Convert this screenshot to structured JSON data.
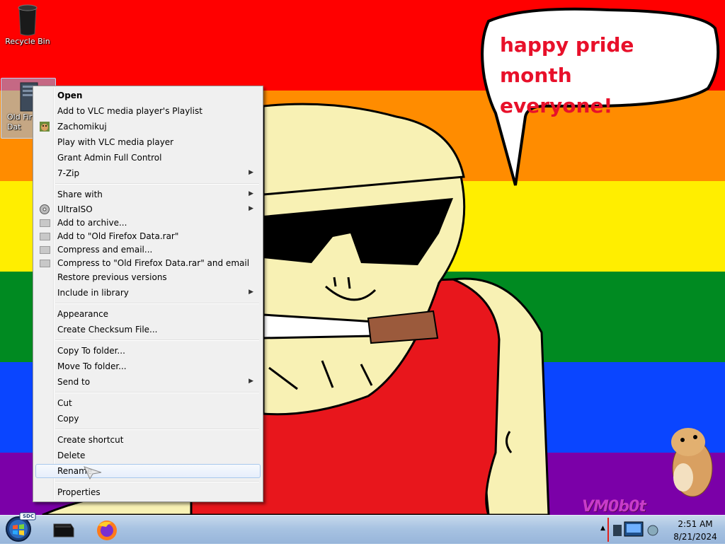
{
  "desktop": {
    "recycle_bin_label": "Recycle Bin",
    "selected_icon_label": "Old Firefox Data",
    "selected_icon_label_visible": "Old Fir\nDat"
  },
  "wallpaper": {
    "speech_line1": "happy pride month",
    "speech_line2": "everyone!",
    "watermark": "VM0b0t",
    "stripe_colors": [
      "#ff0000",
      "#ff8c00",
      "#ffee00",
      "#008a21",
      "#0a45ff",
      "#7b00a8"
    ]
  },
  "context_menu": {
    "items": [
      {
        "label": "Open",
        "bold": true
      },
      {
        "label": "Add to VLC media player's Playlist"
      },
      {
        "label": "Zachomikuj",
        "icon": "hamster-icon"
      },
      {
        "label": "Play with VLC media player"
      },
      {
        "label": "Grant Admin Full Control"
      },
      {
        "label": "7-Zip",
        "submenu": true
      },
      {
        "label": "Share with",
        "submenu": true
      },
      {
        "label": "UltraISO",
        "icon": "disc-icon",
        "submenu": true
      },
      {
        "label": "Add to archive...",
        "icon": "archive-icon"
      },
      {
        "label": "Add to \"Old Firefox Data.rar\"",
        "icon": "archive-icon"
      },
      {
        "label": "Compress and email...",
        "icon": "archive-icon"
      },
      {
        "label": "Compress to \"Old Firefox Data.rar\" and email",
        "icon": "archive-icon"
      },
      {
        "label": "Restore previous versions"
      },
      {
        "label": "Include in library",
        "submenu": true
      },
      {
        "label": "Appearance"
      },
      {
        "label": "Create Checksum File..."
      },
      {
        "label": "Copy To folder..."
      },
      {
        "label": "Move To folder..."
      },
      {
        "label": "Send to",
        "submenu": true
      },
      {
        "label": "Cut"
      },
      {
        "label": "Copy"
      },
      {
        "label": "Create shortcut"
      },
      {
        "label": "Delete"
      },
      {
        "label": "Rename",
        "highlighted": true
      },
      {
        "label": "Properties"
      }
    ]
  },
  "taskbar": {
    "clock_time": "2:51 AM",
    "clock_date": "8/21/2024",
    "pinned_apps": [
      "terminal-icon",
      "firefox-icon"
    ],
    "start_badge": "SDC"
  },
  "colors": {
    "menu_bg": "#f0f0f0",
    "menu_hover_border": "#a8c8ec",
    "speech_text": "#e8102a",
    "taskbar": "#a8c3e2"
  }
}
